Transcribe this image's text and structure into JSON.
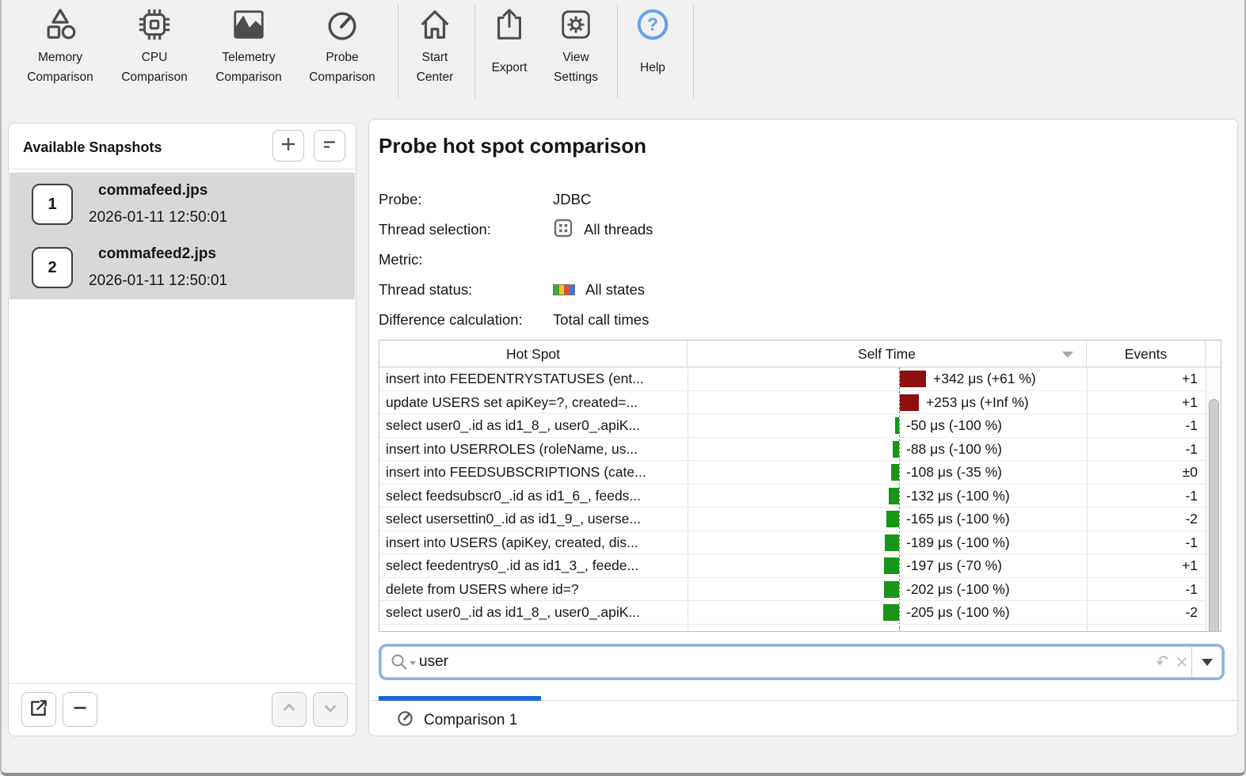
{
  "toolbar": {
    "items": [
      {
        "id": "memory-comparison",
        "label1": "Memory",
        "label2": "Comparison"
      },
      {
        "id": "cpu-comparison",
        "label1": "CPU",
        "label2": "Comparison"
      },
      {
        "id": "telemetry-comparison",
        "label1": "Telemetry",
        "label2": "Comparison"
      },
      {
        "id": "probe-comparison",
        "label1": "Probe",
        "label2": "Comparison"
      },
      {
        "id": "start-center",
        "label1": "Start",
        "label2": "Center"
      },
      {
        "id": "export",
        "label1": "Export",
        "label2": ""
      },
      {
        "id": "view-settings",
        "label1": "View",
        "label2": "Settings"
      },
      {
        "id": "help",
        "label1": "Help",
        "label2": ""
      }
    ]
  },
  "sidebar": {
    "title": "Available Snapshots",
    "snapshots": [
      {
        "index": "1",
        "name": "commafeed.jps",
        "timestamp": "2026-01-11 12:50:01"
      },
      {
        "index": "2",
        "name": "commafeed2.jps",
        "timestamp": "2026-01-11 12:50:01"
      }
    ]
  },
  "main": {
    "title": "Probe hot spot comparison",
    "meta": [
      {
        "label": "Probe:",
        "value": "JDBC"
      },
      {
        "label": "Thread selection:",
        "value": "All threads"
      },
      {
        "label": "Metric:",
        "value": ""
      },
      {
        "label": "Thread status:",
        "value": "All states"
      },
      {
        "label": "Difference calculation:",
        "value": "Total call times"
      }
    ],
    "table": {
      "columns": {
        "hotspot": "Hot Spot",
        "self_time": "Self Time",
        "events": "Events"
      },
      "sorted_by": "Self Time",
      "rows": [
        {
          "hotspot": "insert into FEEDENTRYSTATUSES (ent...",
          "self_time": "+342 μs (+61 %)",
          "value_us": 342,
          "events": "+1"
        },
        {
          "hotspot": "update USERS set apiKey=?, created=...",
          "self_time": "+253 μs (+Inf %)",
          "value_us": 253,
          "events": "+1"
        },
        {
          "hotspot": "select user0_.id as id1_8_, user0_.apiK...",
          "self_time": "-50 μs (-100 %)",
          "value_us": -50,
          "events": "-1"
        },
        {
          "hotspot": "insert into USERROLES (roleName, us...",
          "self_time": "-88 μs (-100 %)",
          "value_us": -88,
          "events": "-1"
        },
        {
          "hotspot": "insert into FEEDSUBSCRIPTIONS (cate...",
          "self_time": "-108 μs (-35 %)",
          "value_us": -108,
          "events": "±0"
        },
        {
          "hotspot": "select feedsubscr0_.id as id1_6_, feeds...",
          "self_time": "-132 μs (-100 %)",
          "value_us": -132,
          "events": "-1"
        },
        {
          "hotspot": "select usersettin0_.id as id1_9_, userse...",
          "self_time": "-165 μs (-100 %)",
          "value_us": -165,
          "events": "-2"
        },
        {
          "hotspot": "insert into USERS (apiKey, created, dis...",
          "self_time": "-189 μs (-100 %)",
          "value_us": -189,
          "events": "-1"
        },
        {
          "hotspot": "select feedentrys0_.id as id1_3_, feede...",
          "self_time": "-197 μs (-70 %)",
          "value_us": -197,
          "events": "+1"
        },
        {
          "hotspot": "delete from USERS where id=?",
          "self_time": "-202 μs (-100 %)",
          "value_us": -202,
          "events": "-1"
        },
        {
          "hotspot": "select user0_.id as id1_8_, user0_.apiK...",
          "self_time": "-205 μs (-100 %)",
          "value_us": -205,
          "events": "-2"
        }
      ]
    },
    "search": {
      "value": "user"
    },
    "tab": {
      "label": "Comparison 1"
    }
  },
  "colors": {
    "positive_bar": "#8e0f0f",
    "negative_bar": "#189418",
    "accent_blue": "#1b66d6",
    "help_blue": "#66a3ea",
    "selection_bg": "#d8d8d8",
    "search_focus_ring": "#8cb2ec",
    "thread_states": [
      "#44a53c",
      "#efc32f",
      "#e2512a",
      "#3b76d9"
    ]
  }
}
